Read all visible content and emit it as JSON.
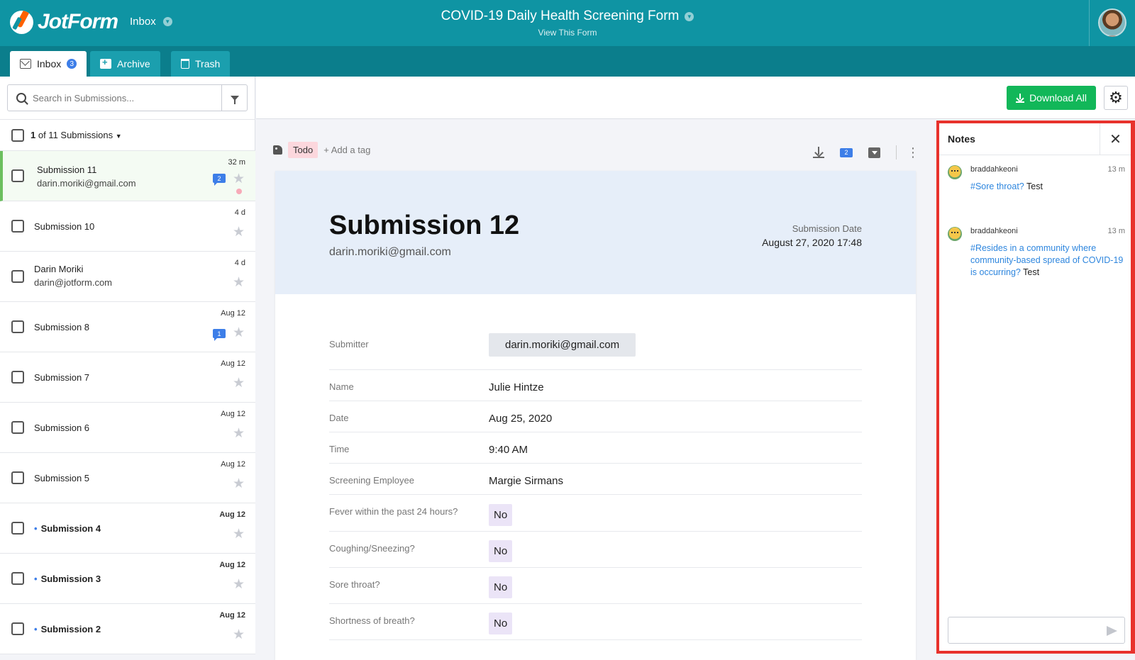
{
  "header": {
    "logo_text": "JotForm",
    "inbox_label": "Inbox",
    "form_title": "COVID-19 Daily Health Screening Form",
    "form_subtitle": "View This Form"
  },
  "tabs": [
    {
      "label": "Inbox",
      "badge": "3"
    },
    {
      "label": "Archive"
    },
    {
      "label": "Trash"
    }
  ],
  "search": {
    "placeholder": "Search in Submissions..."
  },
  "selection": {
    "current": "1",
    "rest": " of 11 Submissions"
  },
  "submissions": [
    {
      "title": "Submission 11",
      "email": "darin.moriki@gmail.com",
      "time": "32 m",
      "notes": "2"
    },
    {
      "title": "Submission 10",
      "email": "",
      "time": "4 d",
      "notes": ""
    },
    {
      "title": "Darin Moriki",
      "email": "darin@jotform.com",
      "time": "4 d",
      "notes": ""
    },
    {
      "title": "Submission 8",
      "email": "",
      "time": "Aug 12",
      "notes": "1"
    },
    {
      "title": "Submission 7",
      "email": "",
      "time": "Aug 12",
      "notes": ""
    },
    {
      "title": "Submission 6",
      "email": "",
      "time": "Aug 12",
      "notes": ""
    },
    {
      "title": "Submission 5",
      "email": "",
      "time": "Aug 12",
      "notes": ""
    },
    {
      "title": "Submission 4",
      "email": "",
      "time": "Aug 12",
      "notes": ""
    },
    {
      "title": "Submission 3",
      "email": "",
      "time": "Aug 12",
      "notes": ""
    },
    {
      "title": "Submission 2",
      "email": "",
      "time": "Aug 12",
      "notes": ""
    }
  ],
  "toolbar": {
    "download_all": "Download All"
  },
  "detail": {
    "tag": "Todo",
    "add_tag": "+ Add a tag",
    "notes_count": "2",
    "title": "Submission 12",
    "email": "darin.moriki@gmail.com",
    "date_label": "Submission Date",
    "date": "August 27, 2020 17:48",
    "fields": [
      {
        "label": "Submitter",
        "value": "darin.moriki@gmail.com"
      },
      {
        "label": "Name",
        "value": "Julie Hintze"
      },
      {
        "label": "Date",
        "value": "Aug 25, 2020"
      },
      {
        "label": "Time",
        "value": "9:40 AM"
      },
      {
        "label": "Screening Employee",
        "value": "Margie Sirmans"
      },
      {
        "label": "Fever within the past 24 hours?",
        "value": "No"
      },
      {
        "label": "Coughing/Sneezing?",
        "value": "No"
      },
      {
        "label": "Sore throat?",
        "value": "No"
      },
      {
        "label": "Shortness of breath?",
        "value": "No"
      }
    ]
  },
  "notes": {
    "title": "Notes",
    "items": [
      {
        "user": "braddahkeoni",
        "time": "13 m",
        "link": "#Sore throat?",
        "text": " Test"
      },
      {
        "user": "braddahkeoni",
        "time": "13 m",
        "link": "#Resides in a community where community-based spread of COVID-19 is occurring?",
        "text": " Test"
      }
    ]
  }
}
